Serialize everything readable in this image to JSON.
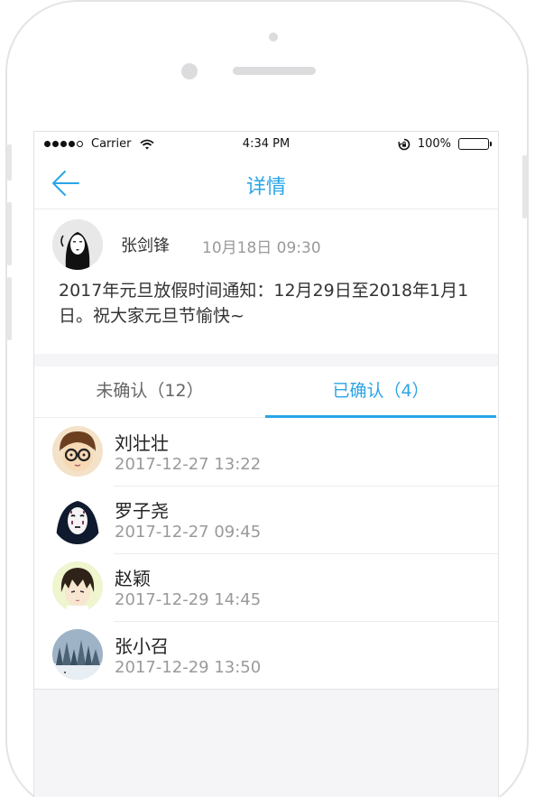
{
  "status_bar": {
    "carrier": "Carrier",
    "time": "4:34 PM",
    "battery": "100%"
  },
  "nav": {
    "title": "详情",
    "back_icon": "arrow-left-icon",
    "accent_color": "#2aa5e6"
  },
  "post": {
    "author": "张剑锋",
    "time": "10月18日 09:30",
    "content": "2017年元旦放假时间通知：12月29日至2018年1月1日。祝大家元旦节愉快~"
  },
  "tabs": [
    {
      "label": "未确认（12）",
      "selected": false
    },
    {
      "label": "已确认（4）",
      "selected": true
    }
  ],
  "list": [
    {
      "name": "刘壮壮",
      "time": "2017-12-27   13:22"
    },
    {
      "name": "罗子尧",
      "time": "2017-12-27   09:45"
    },
    {
      "name": "赵颖",
      "time": "2017-12-29   14:45"
    },
    {
      "name": "张小召",
      "time": "2017-12-29   13:50"
    }
  ]
}
